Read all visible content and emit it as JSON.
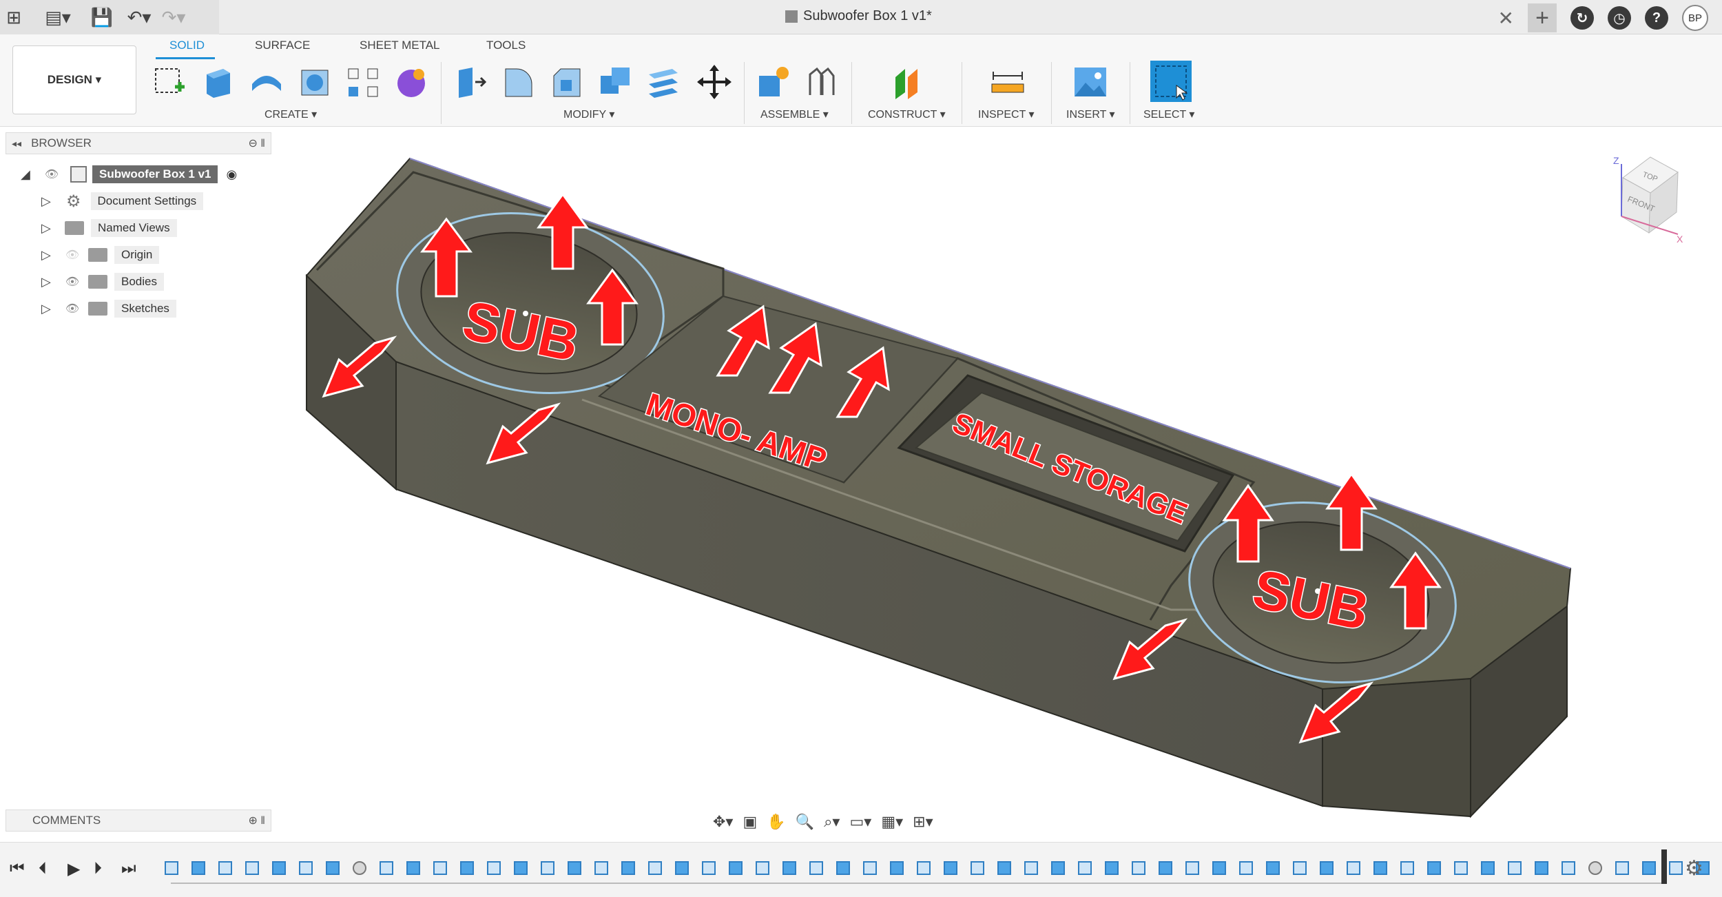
{
  "app": {
    "title": "Subwoofer Box 1 v1*",
    "avatar_initials": "BP",
    "close_icon": "close-icon",
    "new_tab_icon": "plus-icon"
  },
  "ribbon": {
    "workspace": "DESIGN ▾",
    "tabs": [
      {
        "label": "SOLID",
        "active": true
      },
      {
        "label": "SURFACE",
        "active": false
      },
      {
        "label": "SHEET METAL",
        "active": false
      },
      {
        "label": "TOOLS",
        "active": false
      }
    ],
    "groups": {
      "create": "CREATE ▾",
      "modify": "MODIFY ▾",
      "assemble": "ASSEMBLE ▾",
      "construct": "CONSTRUCT ▾",
      "inspect": "INSPECT ▾",
      "insert": "INSERT ▾",
      "select": "SELECT ▾"
    }
  },
  "browser": {
    "header": "BROWSER",
    "root": "Subwoofer Box 1 v1",
    "items": [
      {
        "label": "Document Settings",
        "icon": "gear-icon"
      },
      {
        "label": "Named Views",
        "icon": "folder-icon"
      },
      {
        "label": "Origin",
        "icon": "folder-icon"
      },
      {
        "label": "Bodies",
        "icon": "folder-icon"
      },
      {
        "label": "Sketches",
        "icon": "folder-icon"
      }
    ]
  },
  "comments": {
    "header": "COMMENTS"
  },
  "viewcube": {
    "top": "TOP",
    "front": "FRONT",
    "z_axis": "Z",
    "x_axis": "X"
  },
  "annotations": {
    "sub_left": "SUB",
    "sub_right": "SUB",
    "mono_amp": "MONO- AMP",
    "small_storage": "SMALL STORAGE"
  },
  "colors": {
    "accent": "#1e8fd6",
    "model_body": "#5b5a4f",
    "annotation_red": "#ff1a1a"
  }
}
